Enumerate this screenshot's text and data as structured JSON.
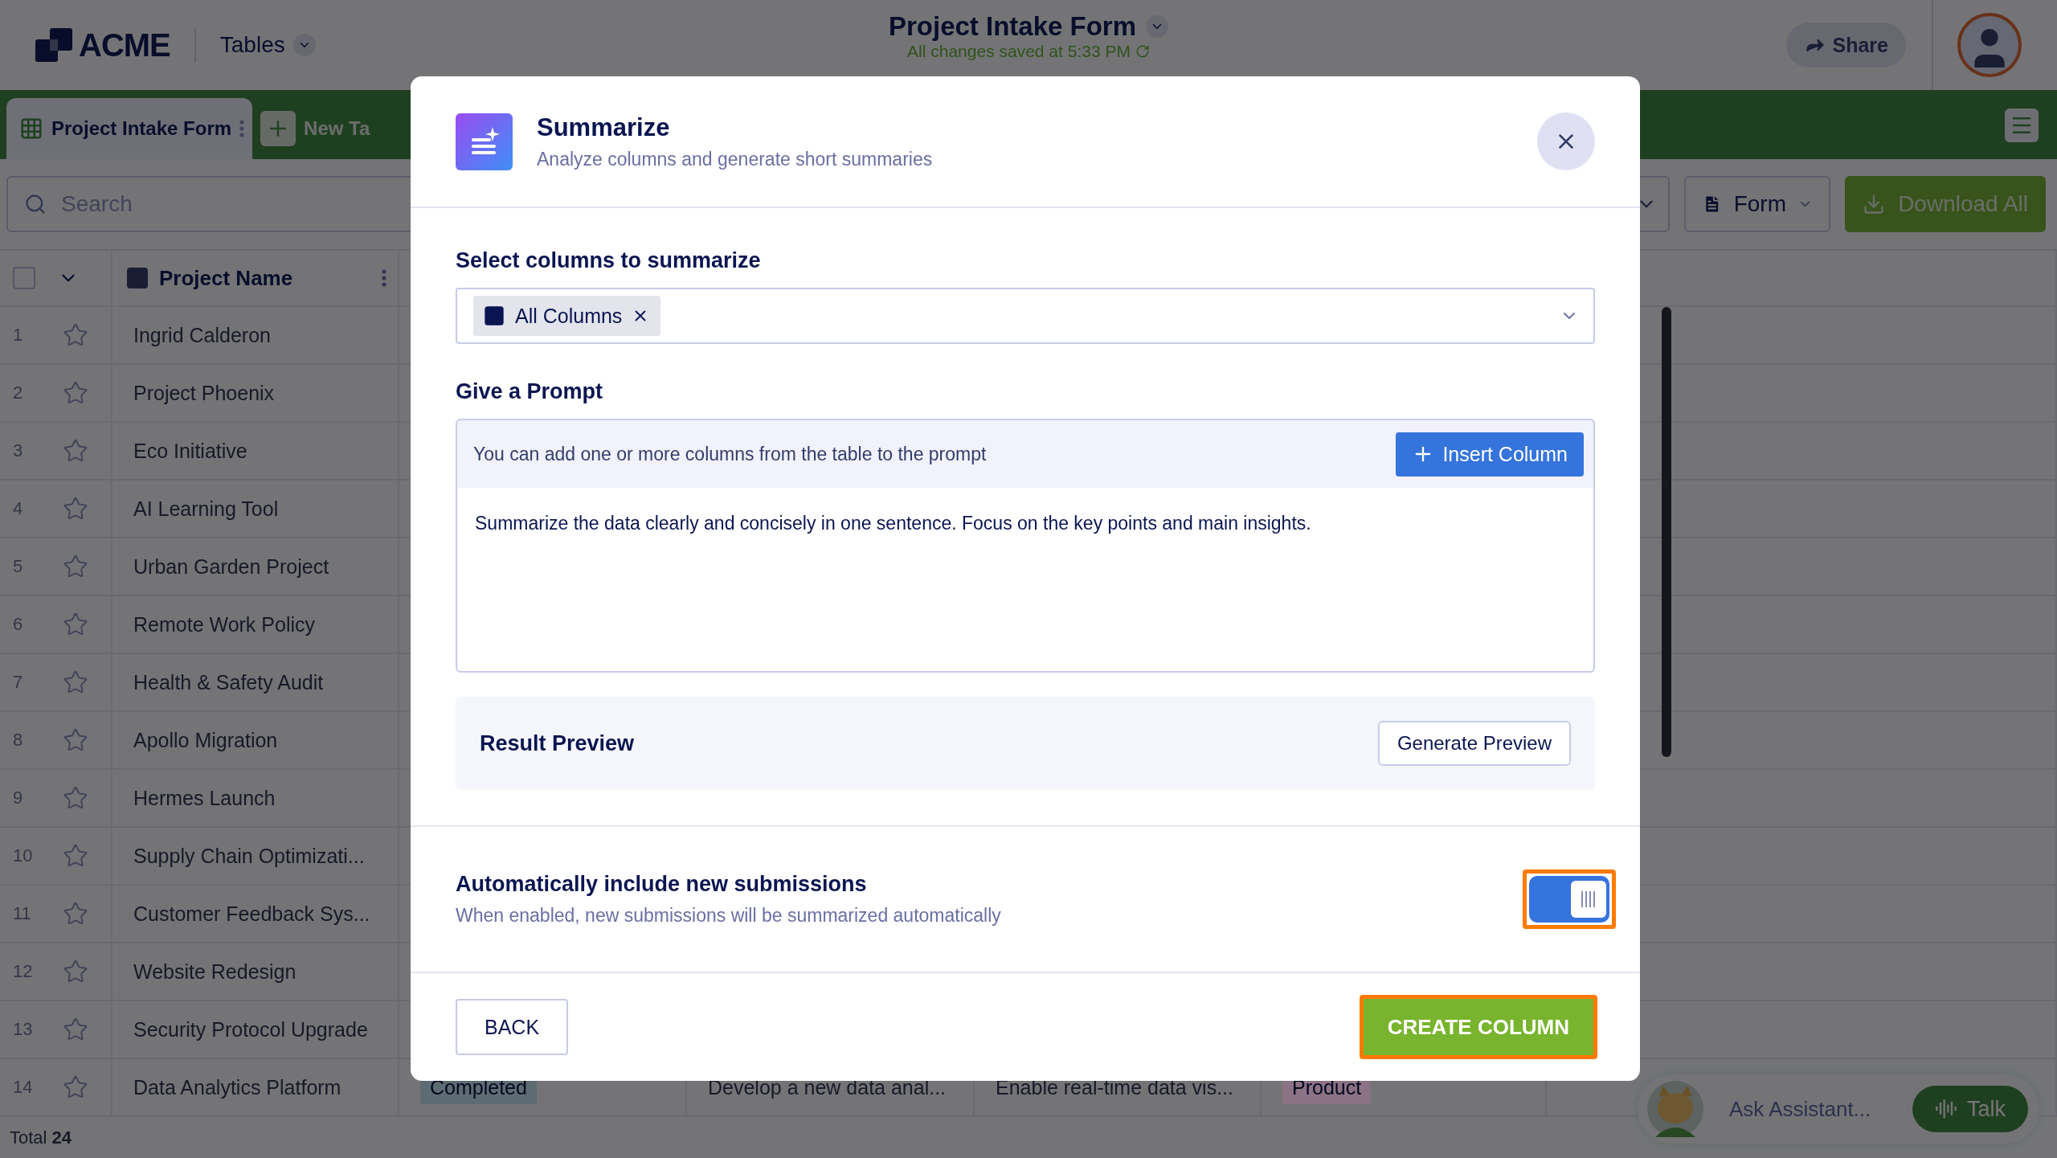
{
  "header": {
    "logo": "ACME",
    "menu": "Tables",
    "title": "Project Intake Form",
    "save_status": "All changes saved at 5:33 PM",
    "share": "Share"
  },
  "tabs": [
    {
      "label": "Project Intake Form",
      "selected": true
    }
  ],
  "new_tab": "New Ta",
  "toolbar": {
    "search_placeholder": "Search",
    "view": "Form",
    "download": "Download All"
  },
  "table": {
    "select_all_checked": false,
    "columns": [
      "Project Name"
    ],
    "rows": [
      {
        "number": "1",
        "name": "Ingrid Calderon",
        "starred": false
      },
      {
        "number": "2",
        "name": "Project Phoenix",
        "starred": false
      },
      {
        "number": "3",
        "name": "Eco Initiative",
        "starred": false
      },
      {
        "number": "4",
        "name": "AI Learning Tool",
        "starred": false
      },
      {
        "number": "5",
        "name": "Urban Garden Project",
        "starred": false
      },
      {
        "number": "6",
        "name": "Remote Work Policy",
        "starred": false
      },
      {
        "number": "7",
        "name": "Health & Safety Audit",
        "starred": false
      },
      {
        "number": "8",
        "name": "Apollo Migration",
        "starred": false
      },
      {
        "number": "9",
        "name": "Hermes Launch",
        "starred": false
      },
      {
        "number": "10",
        "name": "Supply Chain Optimizati...",
        "starred": false
      },
      {
        "number": "11",
        "name": "Customer Feedback Sys...",
        "starred": false
      },
      {
        "number": "12",
        "name": "Website Redesign",
        "starred": false
      },
      {
        "number": "13",
        "name": "Security Protocol Upgrade",
        "starred": false
      },
      {
        "number": "14",
        "name": "Data Analytics Platform",
        "starred": false,
        "cells": [
          {
            "kind": "tag",
            "text": "Completed",
            "color": "#5d6b73"
          },
          {
            "kind": "text",
            "text": "Develop a new data anal..."
          },
          {
            "kind": "text",
            "text": "Enable real-time data vis..."
          },
          {
            "kind": "tag",
            "text": "Product",
            "color": "#8b7284"
          }
        ]
      }
    ],
    "total": "Total **24**"
  },
  "assistant": {
    "placeholder": "Ask Assistant...",
    "talk": "Talk"
  },
  "dialog": {
    "title": "Summarize",
    "subtitle": "Analyze columns and generate short summaries",
    "columns_label": "Select columns to summarize",
    "selected_columns": [
      "All Columns"
    ],
    "prompt_label": "Give a Prompt",
    "prompt_hint": "You can add one or more columns from the table to the prompt",
    "insert_button": "Insert Column",
    "prompt_value": "Summarize the data clearly and concisely in one sentence. Focus on the key points and main insights.",
    "preview_label": "Result Preview",
    "preview_button": "Generate Preview",
    "auto_title": "Automatically include new submissions",
    "auto_subtitle": "When enabled, new submissions will be summarized automatically",
    "auto_on": true,
    "back": "BACK",
    "create": "CREATE COLUMN"
  }
}
